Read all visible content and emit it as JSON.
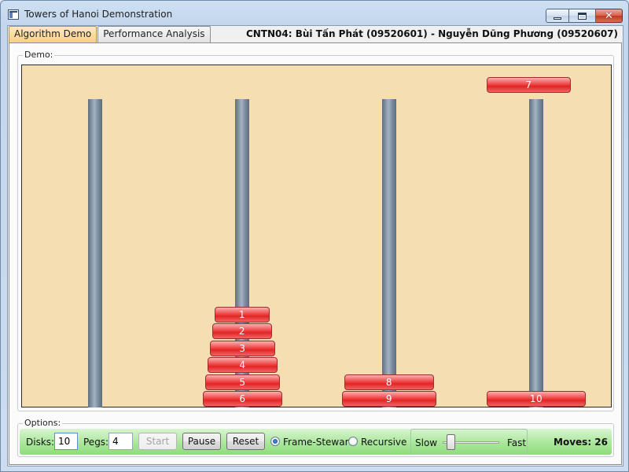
{
  "window": {
    "title": "Towers of Hanoi Demonstration"
  },
  "tabs": [
    {
      "label": "Algorithm Demo",
      "active": true
    },
    {
      "label": "Performance Analysis",
      "active": false
    }
  ],
  "authors": "CNTN04: Bùi Tấn Phát (09520601) - Nguyễn Dũng Phương (09520607)",
  "demo": {
    "group_label": "Demo:",
    "board_color": "#f6deb3",
    "disk_color": "#e83030",
    "pegs": [
      {
        "disks": []
      },
      {
        "disks": [
          "1",
          "2",
          "3",
          "4",
          "5",
          "6"
        ]
      },
      {
        "disks": [
          "8",
          "9"
        ]
      },
      {
        "disks": [
          "10"
        ]
      }
    ],
    "moving_disk": "7"
  },
  "options": {
    "group_label": "Options:",
    "disks_label": "Disks:",
    "disks_value": "10",
    "pegs_label": "Pegs:",
    "pegs_value": "4",
    "start_label": "Start",
    "pause_label": "Pause",
    "reset_label": "Reset",
    "algorithms": [
      {
        "label": "Frame-Stewart",
        "selected": true
      },
      {
        "label": "Recursive",
        "selected": false
      }
    ],
    "speed": {
      "slow_label": "Slow",
      "fast_label": "Fast"
    },
    "moves_text": "Moves: 26"
  }
}
